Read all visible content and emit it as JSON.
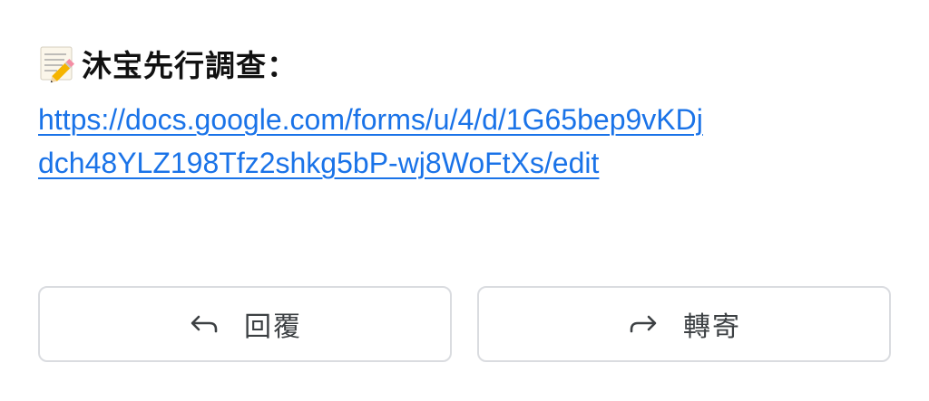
{
  "message": {
    "heading": "沐宝先行調查：",
    "heading_icon": "memo-icon",
    "link_text": "https://docs.google.com/forms/u/4/d/1G65bep9vKDjdch48YLZ198Tfz2shkg5bP-wj8WoFtXs/edit",
    "link_color": "#1a73e8"
  },
  "actions": {
    "reply_label": "回覆",
    "reply_icon": "reply-arrow-icon",
    "forward_label": "轉寄",
    "forward_icon": "forward-arrow-icon",
    "border_color": "#dadce0"
  }
}
